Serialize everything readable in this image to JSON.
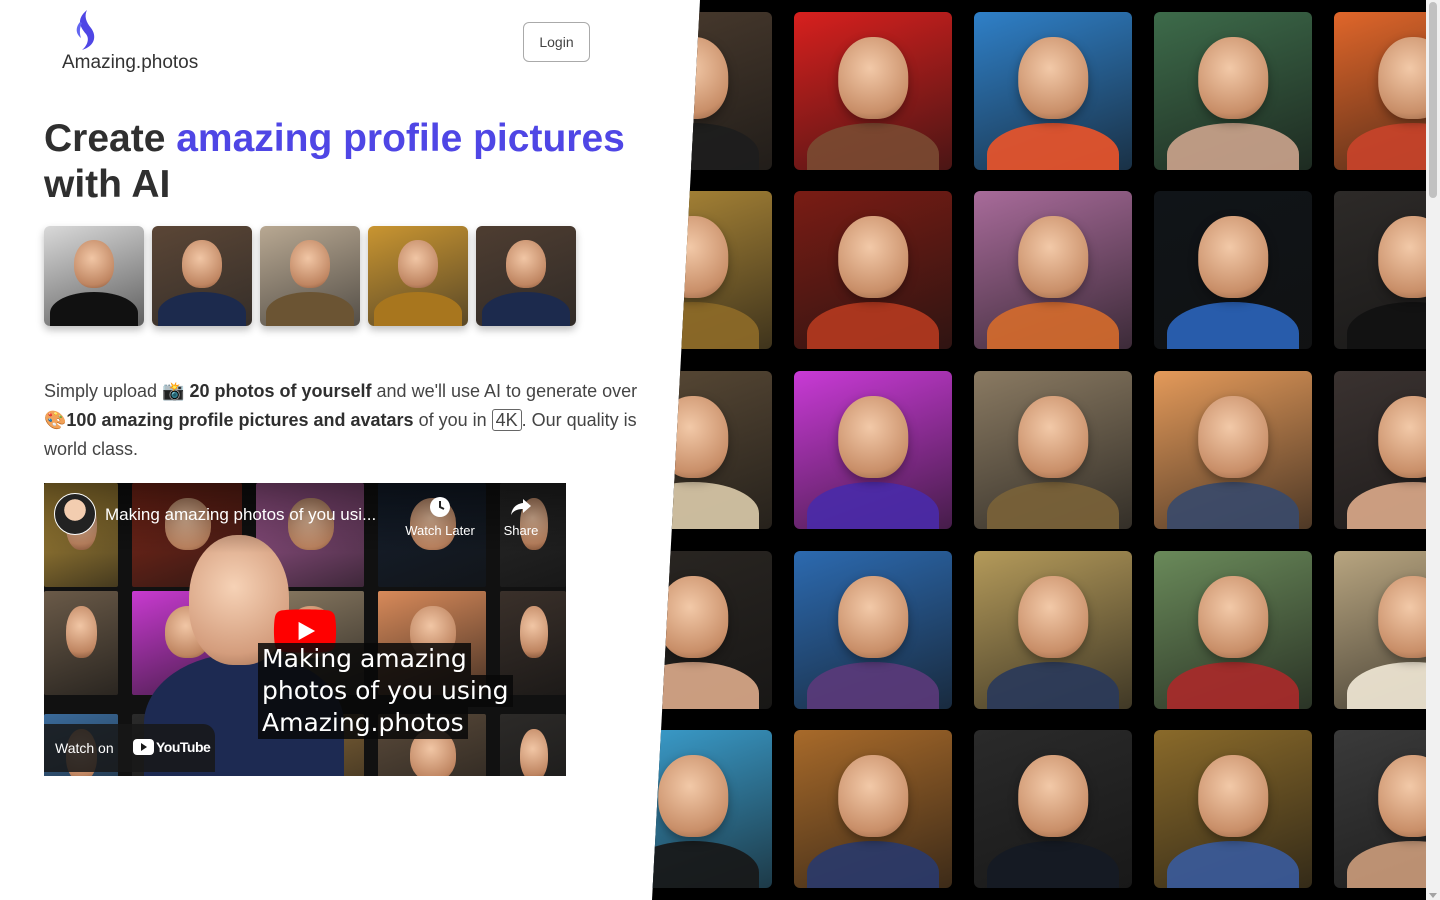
{
  "header": {
    "logo_text": "Amazing.photos",
    "login_label": "Login"
  },
  "hero": {
    "title_lead": "Create ",
    "title_accent": "amazing profile pictures",
    "title_tail": "with AI",
    "intro": {
      "part1": "Simply upload ",
      "camera_emoji": "📸",
      "bold1": " 20 photos of yourself",
      "part2": " and we'll use AI to generate over ",
      "palette_emoji": "🎨",
      "bold2": "100 amazing profile pictures and avatars",
      "part3": " of you in ",
      "resolution": "4K",
      "part4": ". Our quality is world class."
    }
  },
  "video": {
    "title": "Making amazing photos of you usi...",
    "watch_later": "Watch Later",
    "share": "Share",
    "caption_lines": [
      "Making amazing",
      "photos of you using",
      "Amazing.photos"
    ],
    "watch_on": "Watch on",
    "youtube": "YouTube"
  },
  "colors": {
    "accent": "#4f46e5",
    "text": "#333333",
    "gallery_bg": "#000000",
    "youtube_red": "#ff0000"
  },
  "thumbnails": [
    {
      "name": "tuxedo-portrait",
      "bg": "#d9d9d9",
      "body": "#111111"
    },
    {
      "name": "navy-uniform-portrait",
      "bg": "#5b4636",
      "body": "#1c2a4d"
    },
    {
      "name": "military-portrait",
      "bg": "#b8a892",
      "body": "#6b5433"
    },
    {
      "name": "golden-warrior-portrait",
      "bg": "#c99531",
      "body": "#a8761e"
    },
    {
      "name": "navy-uniform-portrait-2",
      "bg": "#4e3d31",
      "body": "#1c2a4d"
    }
  ],
  "gallery": [
    {
      "bg": "#4a3b2e",
      "body": "#1d1d1d"
    },
    {
      "bg": "#d8201e",
      "body": "#7a4a32"
    },
    {
      "bg": "#2f80c8",
      "body": "#e8542a"
    },
    {
      "bg": "#3d6b4a",
      "body": "#c9a28b"
    },
    {
      "bg": "#e0662a",
      "body": "#c8432a"
    },
    {
      "bg": "#b08a38",
      "body": "#8d6a28"
    },
    {
      "bg": "#7a1c14",
      "body": "#b33a1f"
    },
    {
      "bg": "#a86b9a",
      "body": "#d26a2c"
    },
    {
      "bg": "#101418",
      "body": "#2a63b8"
    },
    {
      "bg": "#2d2a28",
      "body": "#111111"
    },
    {
      "bg": "#5a4a36",
      "body": "#d8c8a8"
    },
    {
      "bg": "#c93ad6",
      "body": "#4a2aa8"
    },
    {
      "bg": "#8a7a62",
      "body": "#7a6238"
    },
    {
      "bg": "#e49a5a",
      "body": "#3a4a6a"
    },
    {
      "bg": "#3a3230",
      "body": "#d9a889"
    },
    {
      "bg": "#2a2622",
      "body": "#d9a889"
    },
    {
      "bg": "#2c6ab0",
      "body": "#5a3a7a"
    },
    {
      "bg": "#b49a5a",
      "body": "#2a3a5a"
    },
    {
      "bg": "#6a8a5a",
      "body": "#a82a2a"
    },
    {
      "bg": "#b8a580",
      "body": "#efe6d4"
    },
    {
      "bg": "#3ba0d0",
      "body": "#181818"
    },
    {
      "bg": "#a86a2a",
      "body": "#2a3a6a"
    },
    {
      "bg": "#2a2a2a",
      "body": "#151a24"
    },
    {
      "bg": "#8a6a2a",
      "body": "#3a5a9a"
    },
    {
      "bg": "#3a3a3a",
      "body": "#c99a7a"
    }
  ],
  "video_cells": [
    {
      "bg": "#c8a040"
    },
    {
      "bg": "#8a2a1a"
    },
    {
      "bg": "#b060a0"
    },
    {
      "bg": "#152030"
    },
    {
      "bg": "#2a2a2a"
    },
    {
      "bg": "#6a5a48"
    },
    {
      "bg": "#c83ad0"
    },
    {
      "bg": "#8a7a62"
    },
    {
      "bg": "#d88a5a"
    },
    {
      "bg": "#3a302a"
    },
    {
      "bg": "#3a6a9a"
    },
    {
      "bg": "#2a2a2a"
    },
    {
      "bg": "#8a6a3a"
    },
    {
      "bg": "#5a4a3a"
    },
    {
      "bg": "#2c2a28"
    }
  ]
}
